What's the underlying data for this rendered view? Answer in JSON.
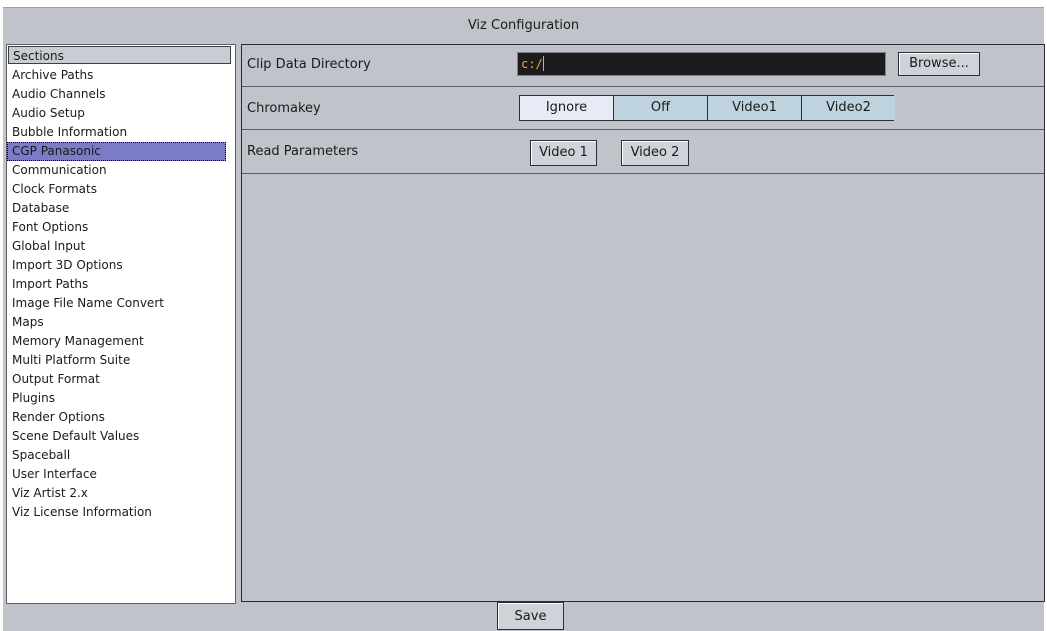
{
  "window": {
    "title": "Viz Configuration"
  },
  "sections": {
    "header": "Sections",
    "items": [
      "Archive Paths",
      "Audio Channels",
      "Audio Setup",
      "Bubble Information",
      "CGP Panasonic",
      "Communication",
      "Clock Formats",
      "Database",
      "Font Options",
      "Global Input",
      "Import 3D Options",
      "Import Paths",
      "Image File Name Convert",
      "Maps",
      "Memory Management",
      "Multi Platform Suite",
      "Output Format",
      "Plugins",
      "Render Options",
      "Scene Default Values",
      "Spaceball",
      "User Interface",
      "Viz Artist 2.x",
      "Viz License Information"
    ],
    "selected": "CGP Panasonic"
  },
  "clip": {
    "label": "Clip Data Directory",
    "value": "c:/",
    "browse_label": "Browse..."
  },
  "chromakey": {
    "label": "Chromakey",
    "options": [
      "Ignore",
      "Off",
      "Video1",
      "Video2"
    ],
    "selected": "Ignore"
  },
  "read_params": {
    "label": "Read Parameters",
    "video1_label": "Video 1",
    "video2_label": "Video 2"
  },
  "footer": {
    "save_label": "Save"
  },
  "colors": {
    "window_bg": "#c0c3ca",
    "selection": "#7b7bc6",
    "input_bg": "#1c1c1e",
    "input_text": "#f0a830",
    "toggle_bg": "#bfd3de",
    "toggle_active_bg": "#e6ebf5"
  }
}
